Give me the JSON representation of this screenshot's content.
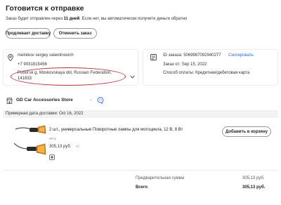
{
  "header": {
    "title": "Готовится к отправке",
    "notice_before": "Заказ будет отправлен через ",
    "notice_days": "11 дней",
    "notice_after": ". Если нет, вы автоматически получите деньги обратно"
  },
  "actions": {
    "extend_label": "Продлевает доставку",
    "cancel_label": "Отменить заказ"
  },
  "address": {
    "name": "melnikov sergey valentinovich",
    "phone": "+7 9031815456",
    "line": "Podol'sk g, Moskovskaya obl, Russian Federation, 141833",
    "icon": "location-pin-icon"
  },
  "order": {
    "id_text": "ID заказа: 5069987092940277",
    "copy_label": "Скопировать",
    "date_text": "Заказ от: Sep 15, 2022",
    "payment_text": "Способ оплаты: Кредитная/дебетовая карта",
    "icon": "receipt-icon"
  },
  "store": {
    "name": "GD Car Accessories Store",
    "arrow": "›",
    "icon": "store-icon",
    "chat_icon": "chat-icon"
  },
  "delivery": {
    "text": "Примерная дата доставки: Oct 16, 2022"
  },
  "product": {
    "title": "2 шт., универсальные Поворотные лампы для мотоцикла, 12 В, 8 Вт",
    "qty": "2Pcs",
    "price": "305,13 руб.",
    "mult": "x1",
    "cart_label": "Добавить в корзину"
  },
  "summary": {
    "subtotal_label": "Предварительная сумма",
    "subtotal_value": "305,13 руб.",
    "total_label": "Всего",
    "total_value": "305,13 руб."
  },
  "colors": {
    "link": "#2f6dd6",
    "annotation": "#b5303a",
    "product_orange": "#e08a1e"
  }
}
